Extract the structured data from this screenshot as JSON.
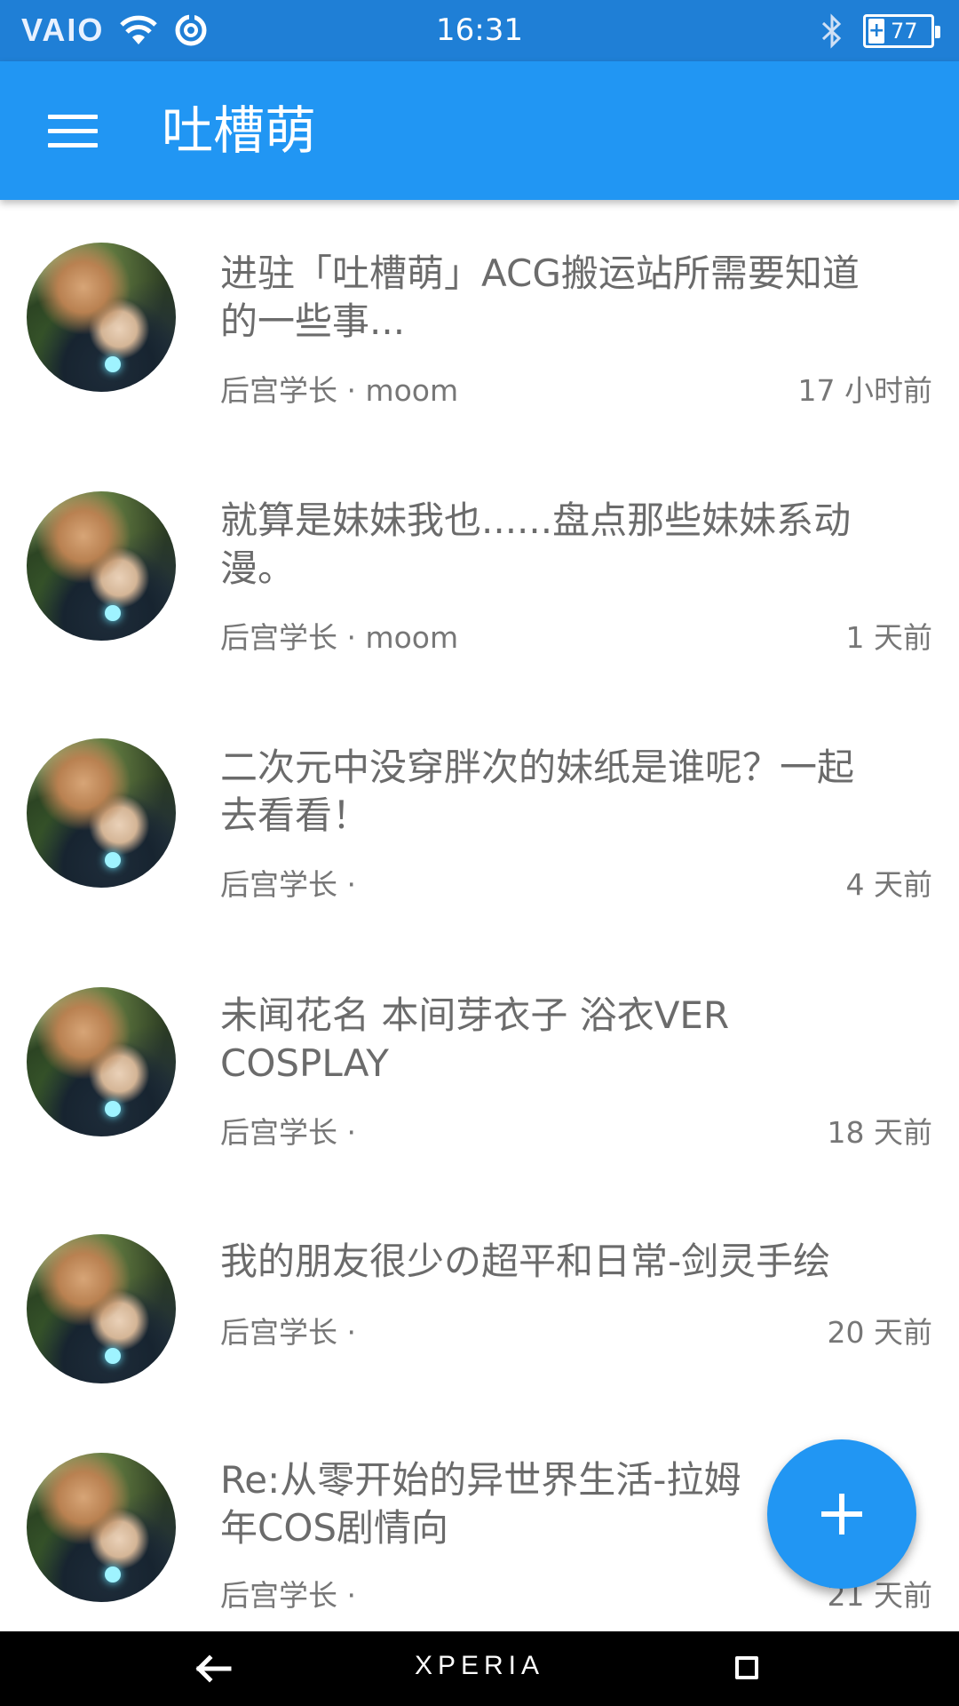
{
  "status_bar": {
    "brand": "VAIO",
    "time": "16:31",
    "battery": "77"
  },
  "app_bar": {
    "title": "吐槽萌"
  },
  "posts": [
    {
      "title_line1": "进驻「吐槽萌」ACG搬运站所需要知道",
      "title_line2": "的一些事...",
      "meta": "后宫学长 · moom",
      "time": "17 小时前"
    },
    {
      "title_line1": "就算是妹妹我也......盘点那些妹妹系动",
      "title_line2": "漫。",
      "meta": "后宫学长 · moom",
      "time": "1 天前"
    },
    {
      "title_line1": "二次元中没穿胖次的妹纸是谁呢？一起",
      "title_line2": "去看看！",
      "meta": "后宫学长 ·",
      "time": "4 天前"
    },
    {
      "title_line1": "未闻花名 本间芽衣子 浴衣VER",
      "title_line2": "COSPLAY",
      "meta": "后宫学长 ·",
      "time": "18 天前"
    },
    {
      "title_line1": "我的朋友很少の超平和日常-剑灵手绘",
      "title_line2": "",
      "meta": "后宫学长 ·",
      "time": "20 天前"
    },
    {
      "title_line1": "Re:从零开始的异世界生活-拉姆",
      "title_line2": "年COS剧情向",
      "meta": "后宫学长 ·",
      "time": "21 天前"
    }
  ],
  "nav_bar": {
    "brand": "XPERIA"
  }
}
